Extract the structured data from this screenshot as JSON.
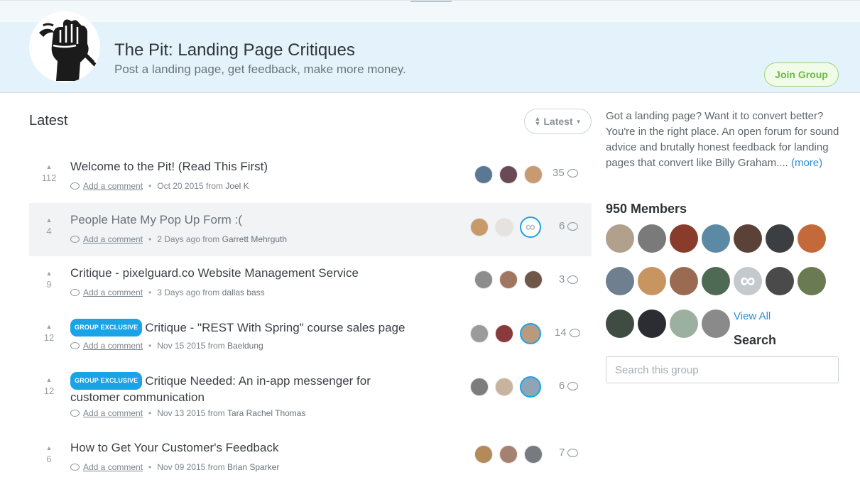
{
  "group": {
    "title": "The Pit: Landing Page Critiques",
    "tagline": "Post a landing page, get feedback, make more money.",
    "join_label": "Join Group",
    "logo_icon": "raised-fist-icon"
  },
  "feed": {
    "heading": "Latest",
    "sort_label": "Latest",
    "threads": [
      {
        "votes": "112",
        "title": "Welcome to the Pit! (Read This First)",
        "badge": "",
        "comment_link": "Add a comment",
        "date": "Oct 20 2015 from",
        "author": "Joel K",
        "count": "35",
        "highlight": false
      },
      {
        "votes": "4",
        "title": "People Hate My Pop Up Form :(",
        "badge": "",
        "comment_link": "Add a comment",
        "date": "2 Days ago from",
        "author": "Garrett Mehrguth",
        "count": "6",
        "highlight": true
      },
      {
        "votes": "9",
        "title": "Critique - pixelguard.co Website Management Service",
        "badge": "",
        "comment_link": "Add a comment",
        "date": "3 Days ago from",
        "author": "dallas bass",
        "count": "3",
        "highlight": false
      },
      {
        "votes": "12",
        "title": "Critique - \"REST With Spring\" course sales page",
        "badge": "GROUP EXCLUSIVE",
        "comment_link": "Add a comment",
        "date": "Nov 15 2015 from",
        "author": "Baeldung",
        "count": "14",
        "highlight": false
      },
      {
        "votes": "12",
        "title": "Critique Needed: An in-app messenger for customer communication",
        "badge": "GROUP EXCLUSIVE",
        "comment_link": "Add a comment",
        "date": "Nov 13 2015 from",
        "author": "Tara Rachel Thomas",
        "count": "6",
        "highlight": false
      },
      {
        "votes": "6",
        "title": "How to Get Your Customer's Feedback",
        "badge": "",
        "comment_link": "Add a comment",
        "date": "Nov 09 2015 from",
        "author": "Brian Sparker",
        "count": "7",
        "highlight": false
      }
    ]
  },
  "sidebar": {
    "about": "Got a landing page? Want it to convert better? You're in the right place. An open forum for sound advice and brutally honest feedback for landing pages that convert like Billy Graham....",
    "more_label": "(more)",
    "members_title": "950 Members",
    "view_all_label": "View All",
    "search_title": "Search",
    "search_placeholder": "Search this group"
  },
  "colors": {
    "accent": "#1ba3e8",
    "banner_bg": "#e4f3fb",
    "join_green": "#6cb84a",
    "link_blue": "#2d8ed1",
    "row_highlight": "#f1f3f5"
  }
}
